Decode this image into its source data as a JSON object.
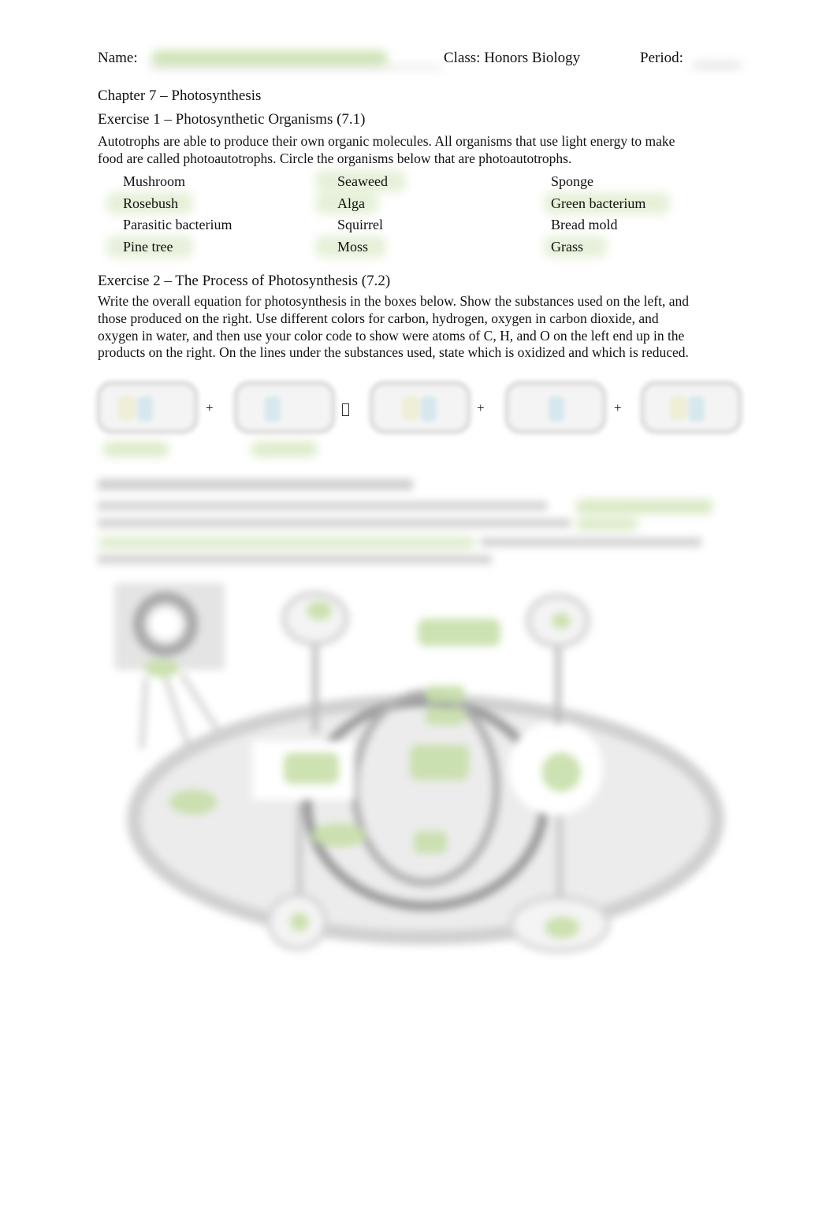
{
  "header": {
    "name_label": "Name:",
    "class_label": "Class: Honors Biology",
    "period_label": "Period:"
  },
  "chapter_title": "Chapter 7 – Photosynthesis",
  "exercise1": {
    "title": "Exercise 1 – Photosynthetic Organisms (7.1)",
    "instructions": "Autotrophs are able to produce their own organic molecules. All organisms that use light energy to make food are called photoautotrophs. Circle the organisms below that are photoautotrophs.",
    "organisms": [
      [
        "Mushroom",
        "Seaweed",
        "Sponge"
      ],
      [
        "Rosebush",
        "Alga",
        "Green bacterium"
      ],
      [
        "Parasitic bacterium",
        "Squirrel",
        "Bread mold"
      ],
      [
        "Pine tree",
        "Moss",
        "Grass"
      ]
    ],
    "circled": [
      "Seaweed",
      "Rosebush",
      "Alga",
      "Green bacterium",
      "Pine tree",
      "Moss",
      "Grass"
    ]
  },
  "exercise2": {
    "title": "Exercise 2 – The Process of Photosynthesis (7.2)",
    "instructions": "Write the overall equation for photosynthesis in the boxes below. Show the substances used on the left, and those produced on the right. Use different colors for carbon, hydrogen, oxygen in carbon dioxide, and oxygen in water, and then use your color code to show were atoms of C, H, and O on the left end up in the products on the right. On the lines under the substances used, state which is oxidized and which is reduced.",
    "plus": "+",
    "arrow": "▯"
  },
  "colors": {
    "highlight_green": "#c8dfaa",
    "blur_gray": "#d6d6d6",
    "box_yellow": "#efeed6",
    "box_blue": "#d6e8ee"
  }
}
